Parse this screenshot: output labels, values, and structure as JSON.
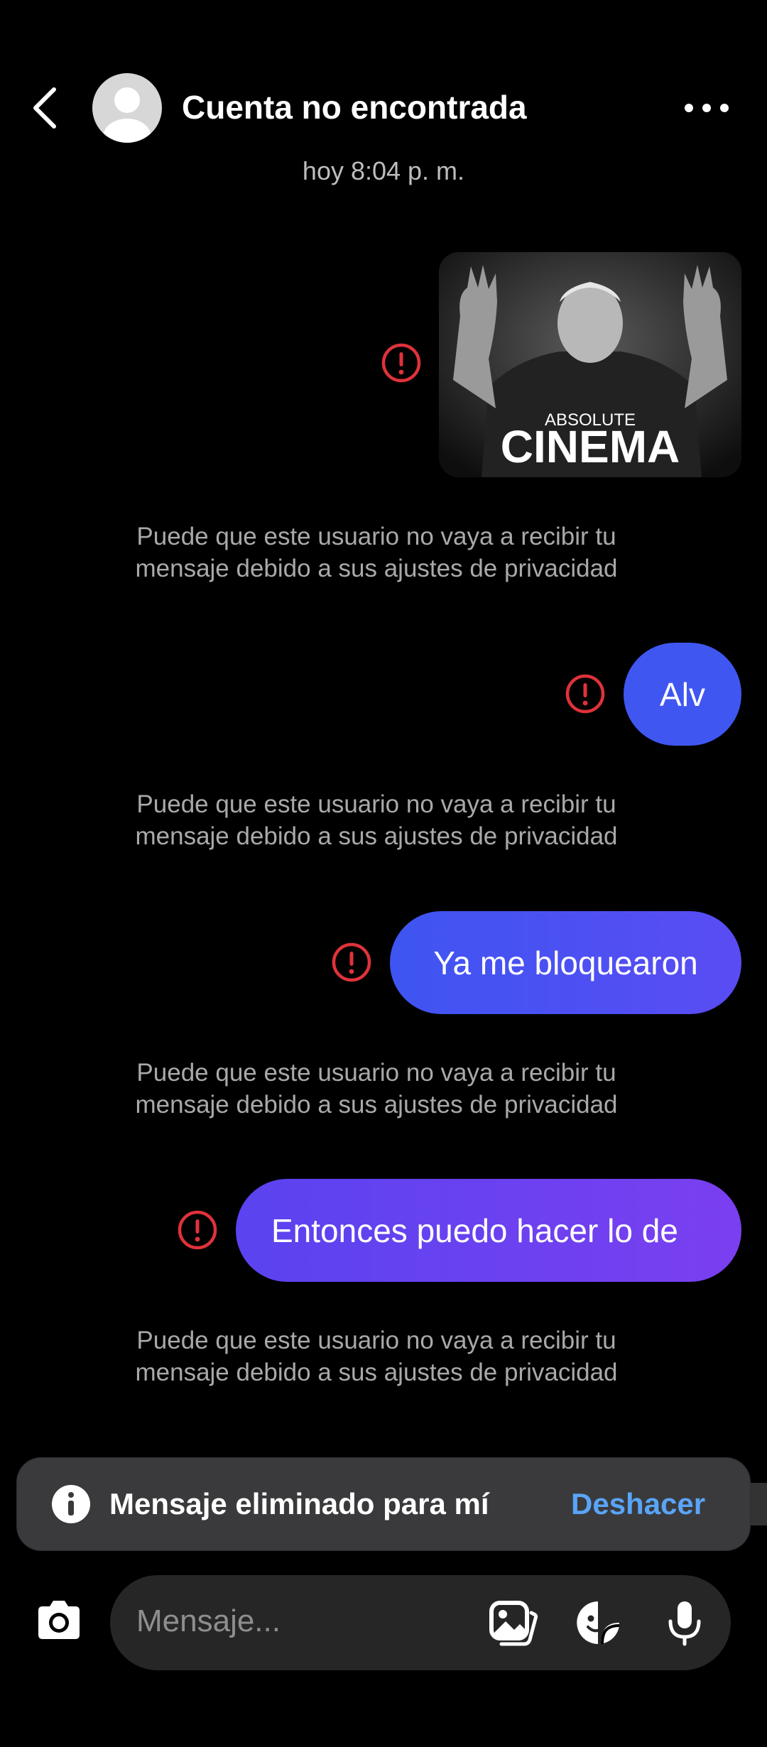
{
  "header": {
    "title": "Cuenta no encontrada"
  },
  "timestamp": "hoy 8:04 p. m.",
  "sticker": {
    "line1": "ABSOLUTE",
    "line2": "CINEMA"
  },
  "messages": [
    {
      "text": "Alv"
    },
    {
      "text": "Ya me bloquearon"
    },
    {
      "text": "Entonces puedo hacer lo de"
    }
  ],
  "privacy_notice": "Puede que este usuario no vaya a recibir tu mensaje debido a sus ajustes de privacidad",
  "toast": {
    "message": "Mensaje eliminado para mí",
    "action": "Deshacer"
  },
  "composer": {
    "placeholder": "Mensaje..."
  },
  "colors": {
    "bubble_blue": "#3f57f0",
    "bubble_purple": "#7a3ff0",
    "error_red": "#e0323a",
    "link_blue": "#59a5f7"
  }
}
